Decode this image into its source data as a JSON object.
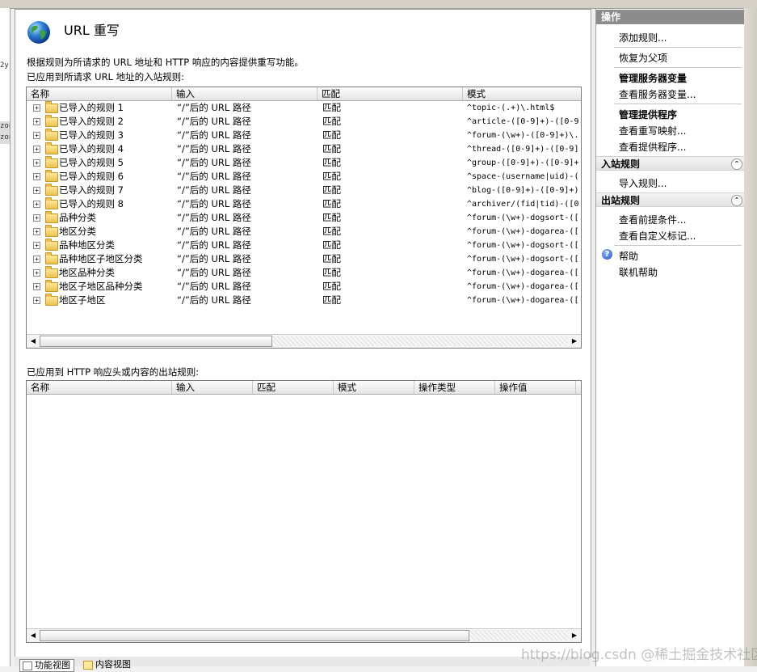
{
  "header": {
    "title": "URL 重写",
    "description": "根据规则为所请求的 URL 地址和 HTTP 响应的内容提供重写功能。"
  },
  "left_strip": {
    "fragments": [
      "2y",
      "zon",
      "zon"
    ]
  },
  "inbound": {
    "label": "已应用到所请求 URL 地址的入站规则:",
    "columns": [
      "名称",
      "输入",
      "匹配",
      "模式"
    ],
    "rows": [
      {
        "name": "已导入的规则 1",
        "input": "“/”后的 URL 路径",
        "match": "匹配",
        "pattern": "^topic-(.+)\\.html$"
      },
      {
        "name": "已导入的规则 2",
        "input": "“/”后的 URL 路径",
        "match": "匹配",
        "pattern": "^article-([0-9]+)-([0-9"
      },
      {
        "name": "已导入的规则 3",
        "input": "“/”后的 URL 路径",
        "match": "匹配",
        "pattern": "^forum-(\\w+)-([0-9]+)\\."
      },
      {
        "name": "已导入的规则 4",
        "input": "“/”后的 URL 路径",
        "match": "匹配",
        "pattern": "^thread-([0-9]+)-([0-9]"
      },
      {
        "name": "已导入的规则 5",
        "input": "“/”后的 URL 路径",
        "match": "匹配",
        "pattern": "^group-([0-9]+)-([0-9]+"
      },
      {
        "name": "已导入的规则 6",
        "input": "“/”后的 URL 路径",
        "match": "匹配",
        "pattern": "^space-(username|uid)-("
      },
      {
        "name": "已导入的规则 7",
        "input": "“/”后的 URL 路径",
        "match": "匹配",
        "pattern": "^blog-([0-9]+)-([0-9]+)"
      },
      {
        "name": "已导入的规则 8",
        "input": "“/”后的 URL 路径",
        "match": "匹配",
        "pattern": "^archiver/(fid|tid)-([0"
      },
      {
        "name": "品种分类",
        "input": "“/”后的 URL 路径",
        "match": "匹配",
        "pattern": "^forum-(\\w+)-dogsort-(["
      },
      {
        "name": "地区分类",
        "input": "“/”后的 URL 路径",
        "match": "匹配",
        "pattern": "^forum-(\\w+)-dogarea-(["
      },
      {
        "name": "品种地区分类",
        "input": "“/”后的 URL 路径",
        "match": "匹配",
        "pattern": "^forum-(\\w+)-dogsort-(["
      },
      {
        "name": "品种地区子地区分类",
        "input": "“/”后的 URL 路径",
        "match": "匹配",
        "pattern": "^forum-(\\w+)-dogsort-(["
      },
      {
        "name": "地区品种分类",
        "input": "“/”后的 URL 路径",
        "match": "匹配",
        "pattern": "^forum-(\\w+)-dogarea-(["
      },
      {
        "name": "地区子地区品种分类",
        "input": "“/”后的 URL 路径",
        "match": "匹配",
        "pattern": "^forum-(\\w+)-dogarea-(["
      },
      {
        "name": "地区子地区",
        "input": "“/”后的 URL 路径",
        "match": "匹配",
        "pattern": "^forum-(\\w+)-dogarea-(["
      }
    ]
  },
  "outbound": {
    "label": "已应用到 HTTP 响应头或内容的出站规则:",
    "columns": [
      "名称",
      "输入",
      "匹配",
      "模式",
      "操作类型",
      "操作值"
    ]
  },
  "actions": {
    "header": "操作",
    "add_rule": "添加规则...",
    "revert_parent": "恢复为父项",
    "server_vars_title": "管理服务器变量",
    "view_server_vars": "查看服务器变量...",
    "providers_title": "管理提供程序",
    "view_rewrite_maps": "查看重写映射...",
    "view_providers": "查看提供程序...",
    "inbound_title": "入站规则",
    "import_rules": "导入规则...",
    "outbound_title": "出站规则",
    "view_preconditions": "查看前提条件...",
    "view_custom_tags": "查看自定义标记...",
    "help": "帮助",
    "online_help": "联机帮助"
  },
  "bottom_tabs": {
    "features_view": "功能视图",
    "content_view": "内容视图"
  },
  "watermark": "https://blog.csdn @稀土掘金技术社区",
  "colors": {
    "actions_header_bg": "#8c8c8c",
    "panel_bg": "#ffffff",
    "grid_border": "#7a7a7a"
  }
}
